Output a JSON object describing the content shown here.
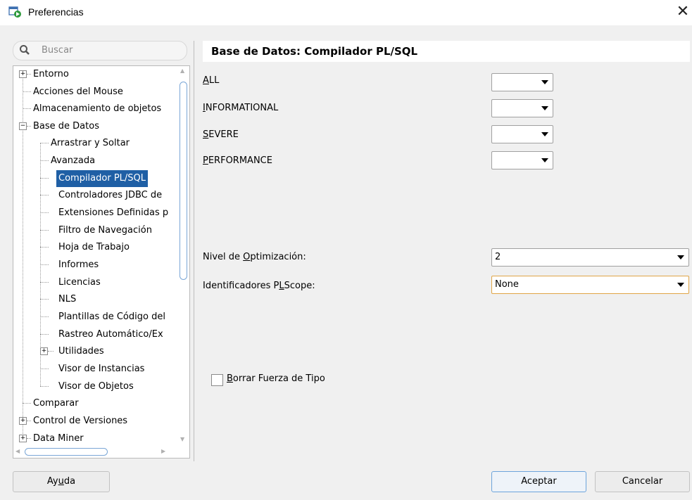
{
  "window": {
    "title": "Preferencias"
  },
  "search": {
    "placeholder": "Buscar"
  },
  "tree": [
    "Entorno",
    "Acciones del Mouse",
    "Almacenamiento de objetos",
    "Base de Datos",
    "Arrastrar y Soltar",
    "Avanzada",
    "Compilador PL/SQL",
    "Controladores JDBC de",
    "Extensiones Definidas p",
    "Filtro de Navegación",
    "Hoja de Trabajo",
    "Informes",
    "Licencias",
    "NLS",
    "Plantillas de Código del",
    "Rastreo Automático/Ex",
    "Utilidades",
    "Visor de Instancias",
    "Visor de Objetos",
    "Comparar",
    "Control de Versiones",
    "Data Miner"
  ],
  "panel": {
    "title": "Base de Datos: Compilador PL/SQL",
    "warnings": [
      {
        "mn": "A",
        "rest": "LL"
      },
      {
        "mn": "I",
        "rest": "NFORMATIONAL"
      },
      {
        "mn": "S",
        "rest": "EVERE"
      },
      {
        "mn": "P",
        "rest": "ERFORMANCE"
      }
    ],
    "opt_level": {
      "pre": "Nivel de ",
      "mn": "O",
      "post": "ptimización:",
      "value": "2"
    },
    "plscope": {
      "pre": "Identificadores P",
      "mn": "L",
      "post": "Scope:",
      "value": "None"
    },
    "checkbox": {
      "mn": "B",
      "rest": "orrar Fuerza de Tipo"
    }
  },
  "buttons": {
    "help": {
      "pre": "Ay",
      "mn": "u",
      "post": "da"
    },
    "ok": "Aceptar",
    "cancel": "Cancelar"
  },
  "colors": {
    "selection": "#1f5fa5",
    "focus_border": "#e0a546"
  }
}
